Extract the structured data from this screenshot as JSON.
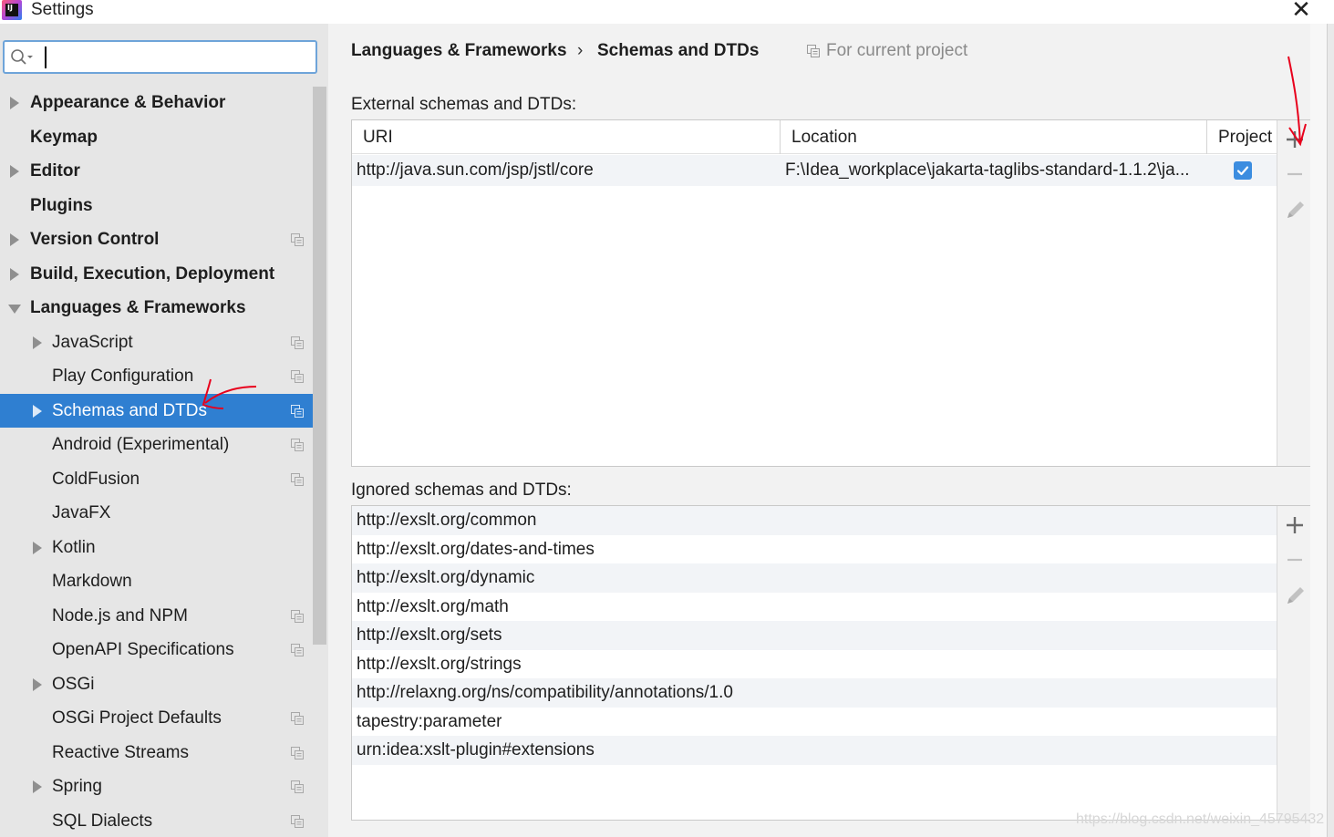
{
  "window": {
    "app_icon_text": "IJ",
    "title": "Settings",
    "close_glyph": "✕"
  },
  "search": {
    "value": "",
    "placeholder": ""
  },
  "sidebar": {
    "items": [
      {
        "label": "Appearance & Behavior",
        "bold": true,
        "arrow": "right",
        "level": 0,
        "project_icon": false
      },
      {
        "label": "Keymap",
        "bold": true,
        "arrow": "none",
        "level": 0,
        "project_icon": false
      },
      {
        "label": "Editor",
        "bold": true,
        "arrow": "right",
        "level": 0,
        "project_icon": false
      },
      {
        "label": "Plugins",
        "bold": true,
        "arrow": "none",
        "level": 0,
        "project_icon": false
      },
      {
        "label": "Version Control",
        "bold": true,
        "arrow": "right",
        "level": 0,
        "project_icon": true
      },
      {
        "label": "Build, Execution, Deployment",
        "bold": true,
        "arrow": "right",
        "level": 0,
        "project_icon": false
      },
      {
        "label": "Languages & Frameworks",
        "bold": true,
        "arrow": "down",
        "level": 0,
        "project_icon": false
      },
      {
        "label": "JavaScript",
        "bold": false,
        "arrow": "right",
        "level": 1,
        "project_icon": true
      },
      {
        "label": "Play Configuration",
        "bold": false,
        "arrow": "none",
        "level": 1,
        "project_icon": true
      },
      {
        "label": "Schemas and DTDs",
        "bold": false,
        "arrow": "right",
        "level": 1,
        "project_icon": true,
        "selected": true
      },
      {
        "label": "Android (Experimental)",
        "bold": false,
        "arrow": "none",
        "level": 1,
        "project_icon": true
      },
      {
        "label": "ColdFusion",
        "bold": false,
        "arrow": "none",
        "level": 1,
        "project_icon": true
      },
      {
        "label": "JavaFX",
        "bold": false,
        "arrow": "none",
        "level": 1,
        "project_icon": false
      },
      {
        "label": "Kotlin",
        "bold": false,
        "arrow": "right",
        "level": 1,
        "project_icon": false
      },
      {
        "label": "Markdown",
        "bold": false,
        "arrow": "none",
        "level": 1,
        "project_icon": false
      },
      {
        "label": "Node.js and NPM",
        "bold": false,
        "arrow": "none",
        "level": 1,
        "project_icon": true
      },
      {
        "label": "OpenAPI Specifications",
        "bold": false,
        "arrow": "none",
        "level": 1,
        "project_icon": true
      },
      {
        "label": "OSGi",
        "bold": false,
        "arrow": "right",
        "level": 1,
        "project_icon": false
      },
      {
        "label": "OSGi Project Defaults",
        "bold": false,
        "arrow": "none",
        "level": 1,
        "project_icon": true
      },
      {
        "label": "Reactive Streams",
        "bold": false,
        "arrow": "none",
        "level": 1,
        "project_icon": true
      },
      {
        "label": "Spring",
        "bold": false,
        "arrow": "right",
        "level": 1,
        "project_icon": true
      },
      {
        "label": "SQL Dialects",
        "bold": false,
        "arrow": "none",
        "level": 1,
        "project_icon": true
      }
    ]
  },
  "breadcrumb": {
    "parent": "Languages & Frameworks",
    "separator": "›",
    "current": "Schemas and DTDs"
  },
  "scope_note": "For current project",
  "external": {
    "label": "External schemas and DTDs:",
    "columns": [
      "URI",
      "Location",
      "Project"
    ],
    "rows": [
      {
        "uri": "http://java.sun.com/jsp/jstl/core",
        "location": "F:\\Idea_workplace\\jakarta-taglibs-standard-1.1.2\\ja...",
        "project": true
      }
    ]
  },
  "ignored": {
    "label": "Ignored schemas and DTDs:",
    "rows": [
      "http://exslt.org/common",
      "http://exslt.org/dates-and-times",
      "http://exslt.org/dynamic",
      "http://exslt.org/math",
      "http://exslt.org/sets",
      "http://exslt.org/strings",
      "http://relaxng.org/ns/compatibility/annotations/1.0",
      "tapestry:parameter",
      "urn:idea:xslt-plugin#extensions"
    ]
  },
  "watermark": "https://blog.csdn.net/weixin_45795432",
  "colors": {
    "selection": "#2f7fd1",
    "checkbox": "#3c8de0",
    "annotation": "#e8001c"
  },
  "icons": {
    "search": "search-icon",
    "add": "plus-icon",
    "remove": "minus-icon",
    "edit": "pencil-icon",
    "project_scope": "project-scope-icon"
  }
}
